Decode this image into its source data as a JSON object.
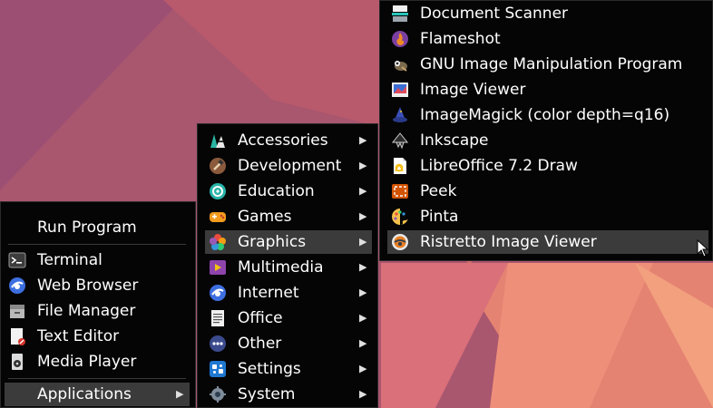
{
  "colors": {
    "menu_bg": "#050505",
    "highlight_bg": "#3b3b3b",
    "text": "#ffffff",
    "wallpaper_base": "#b0556f"
  },
  "main_menu": {
    "items": [
      {
        "label": "Run Program",
        "icon": ""
      },
      {
        "label": "Terminal",
        "icon": "terminal-icon"
      },
      {
        "label": "Web Browser",
        "icon": "web-browser-icon"
      },
      {
        "label": "File Manager",
        "icon": "file-manager-icon"
      },
      {
        "label": "Text Editor",
        "icon": "text-editor-icon"
      },
      {
        "label": "Media Player",
        "icon": "media-player-icon"
      },
      {
        "label": "Applications",
        "icon": "",
        "submenu_arrow": "▶"
      }
    ]
  },
  "applications_menu": {
    "items": [
      {
        "label": "Accessories",
        "icon": "accessories-icon",
        "arrow": "▶"
      },
      {
        "label": "Development",
        "icon": "development-icon",
        "arrow": "▶"
      },
      {
        "label": "Education",
        "icon": "education-icon",
        "arrow": "▶"
      },
      {
        "label": "Games",
        "icon": "games-icon",
        "arrow": "▶"
      },
      {
        "label": "Graphics",
        "icon": "graphics-icon",
        "arrow": "▶"
      },
      {
        "label": "Multimedia",
        "icon": "multimedia-icon",
        "arrow": "▶"
      },
      {
        "label": "Internet",
        "icon": "internet-icon",
        "arrow": "▶"
      },
      {
        "label": "Office",
        "icon": "office-icon",
        "arrow": "▶"
      },
      {
        "label": "Other",
        "icon": "other-icon",
        "arrow": "▶"
      },
      {
        "label": "Settings",
        "icon": "settings-icon",
        "arrow": "▶"
      },
      {
        "label": "System",
        "icon": "system-icon",
        "arrow": "▶"
      }
    ]
  },
  "graphics_menu": {
    "items": [
      {
        "label": "Document Scanner",
        "icon": "document-scanner-icon"
      },
      {
        "label": "Flameshot",
        "icon": "flameshot-icon"
      },
      {
        "label": "GNU Image Manipulation Program",
        "icon": "gimp-icon"
      },
      {
        "label": "Image Viewer",
        "icon": "image-viewer-icon"
      },
      {
        "label": "ImageMagick (color depth=q16)",
        "icon": "imagemagick-icon"
      },
      {
        "label": "Inkscape",
        "icon": "inkscape-icon"
      },
      {
        "label": "LibreOffice 7.2 Draw",
        "icon": "libreoffice-draw-icon"
      },
      {
        "label": "Peek",
        "icon": "peek-icon"
      },
      {
        "label": "Pinta",
        "icon": "pinta-icon"
      },
      {
        "label": "Ristretto Image Viewer",
        "icon": "ristretto-icon"
      }
    ]
  }
}
